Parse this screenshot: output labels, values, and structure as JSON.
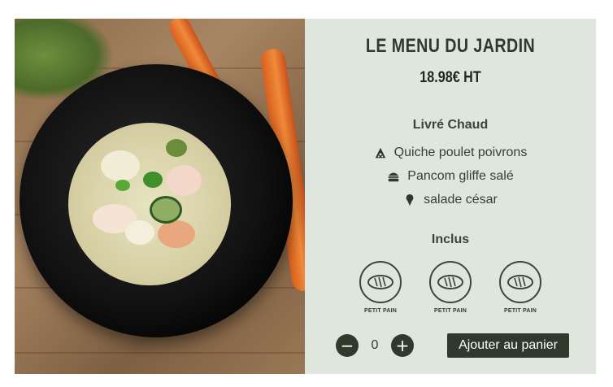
{
  "product": {
    "title": "LE MENU DU JARDIN",
    "price": "18.98€ HT",
    "image_icon": "food-photo"
  },
  "delivery": {
    "label": "Livré Chaud",
    "items": [
      {
        "icon": "pizza-slice-icon",
        "label": "Quiche poulet poivrons"
      },
      {
        "icon": "burger-icon",
        "label": "Pancom gliffe salé"
      },
      {
        "icon": "ice-cream-icon",
        "label": "salade césar"
      }
    ]
  },
  "included": {
    "label": "Inclus",
    "items": [
      {
        "icon": "bread-icon",
        "label": "PETIT PAIN"
      },
      {
        "icon": "bread-icon",
        "label": "PETIT PAIN"
      },
      {
        "icon": "bread-icon",
        "label": "PETIT PAIN"
      }
    ]
  },
  "controls": {
    "minus": "−",
    "quantity": "0",
    "plus": "+",
    "add_to_cart": "Ajouter au panier"
  },
  "colors": {
    "panel": "#dfe6de",
    "dark": "#2f3a2c"
  }
}
